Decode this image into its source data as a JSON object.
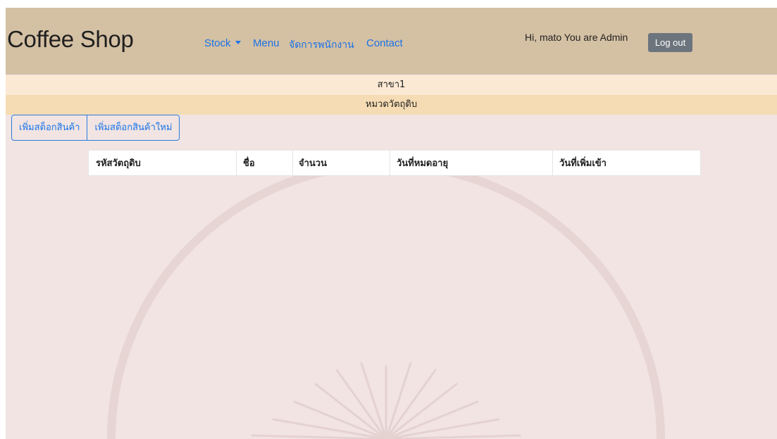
{
  "navbar": {
    "brand": "Coffee Shop",
    "links": [
      {
        "label": "Stock"
      },
      {
        "label": "Menu"
      },
      {
        "label": "จัดการพนักงาน"
      },
      {
        "label": "Contact"
      }
    ],
    "greeting": "Hi, mato You are Admin",
    "logout_label": "Log out"
  },
  "branch_bar": {
    "text": "สาขา1"
  },
  "category_bar": {
    "text": "หมวดวัตถุดิบ"
  },
  "actions": {
    "add_stock": "เพิ่มสต็อกสินค้า",
    "add_new_stock": "เพิ่มสต็อกสินค้าใหม่"
  },
  "table": {
    "columns": [
      "รหัสวัตถุดิบ",
      "ชื่อ",
      "จำนวน",
      "วันที่หมดอายุ",
      "วันที่เพิ่มเข้า"
    ],
    "rows": []
  },
  "colors": {
    "navbar_bg": "#d4c0a3",
    "link": "#1a73e8",
    "branch_bar_bg": "#fbe9d4",
    "category_bar_bg": "#f5dcb4",
    "page_bg": "#f1e4e2",
    "logout_bg": "#6c757d"
  }
}
